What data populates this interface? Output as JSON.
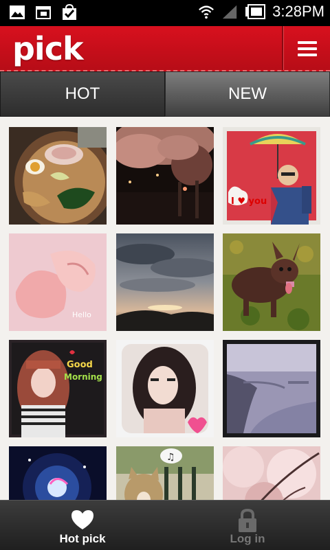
{
  "status_bar": {
    "time": "3:28PM",
    "icons": [
      "gallery-notification-icon",
      "calendar-notification-icon",
      "shopping-bag-notification-icon",
      "wifi-icon",
      "signal-icon",
      "battery-icon"
    ]
  },
  "header": {
    "logo_text": "pick",
    "menu_icon": "hamburger-menu-icon",
    "brand_color": "#c8111c"
  },
  "tabs": [
    {
      "label": "HOT",
      "selected": true
    },
    {
      "label": "NEW",
      "selected": false
    }
  ],
  "grid": {
    "photos": [
      {
        "name": "photo-ramen"
      },
      {
        "name": "photo-night-cherry-blossoms"
      },
      {
        "name": "photo-man-umbrella-i-love-you"
      },
      {
        "name": "photo-baby-hands-hello"
      },
      {
        "name": "photo-sunset-sky"
      },
      {
        "name": "photo-chihuahua-grass"
      },
      {
        "name": "photo-girl-good-morning"
      },
      {
        "name": "photo-girl-portrait-heart"
      },
      {
        "name": "photo-coastline"
      },
      {
        "name": "photo-light-spiral"
      },
      {
        "name": "photo-cat-music"
      },
      {
        "name": "photo-cherry-blossoms"
      }
    ]
  },
  "bottom_nav": [
    {
      "label": "Hot pick",
      "icon": "heart-icon",
      "active": true
    },
    {
      "label": "Log in",
      "icon": "lock-icon",
      "active": false
    }
  ]
}
